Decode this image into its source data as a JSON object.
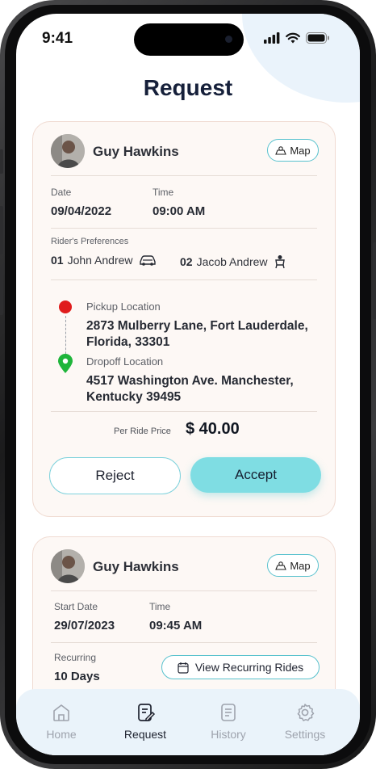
{
  "status_bar": {
    "time": "9:41"
  },
  "page": {
    "title": "Request"
  },
  "requests": [
    {
      "rider_name": "Guy Hawkins",
      "map_label": "Map",
      "date_label": "Date",
      "date": "09/04/2022",
      "time_label": "Time",
      "time": "09:00 AM",
      "preferences_label": "Rider's Preferences",
      "preferences": [
        {
          "number": "01",
          "name": "John Andrew",
          "icon": "car-icon"
        },
        {
          "number": "02",
          "name": "Jacob Andrew",
          "icon": "child-seat-icon"
        }
      ],
      "pickup_label": "Pickup Location",
      "pickup_address": "2873 Mulberry Lane, Fort Lauderdale, Florida, 33301",
      "dropoff_label": "Dropoff Location",
      "dropoff_address": "4517 Washington Ave. Manchester, Kentucky 39495",
      "price_label": "Per Ride Price",
      "price": "$ 40.00",
      "reject_label": "Reject",
      "accept_label": "Accept"
    },
    {
      "rider_name": "Guy Hawkins",
      "map_label": "Map",
      "start_date_label": "Start Date",
      "start_date": "29/07/2023",
      "time_label": "Time",
      "time": "09:45 AM",
      "recurring_label": "Recurring",
      "recurring_value": "10 Days",
      "view_recurring_label": "View Recurring Rides"
    }
  ],
  "tab_bar": {
    "items": [
      {
        "label": "Home",
        "icon": "home-icon",
        "active": false
      },
      {
        "label": "Request",
        "icon": "request-icon",
        "active": true
      },
      {
        "label": "History",
        "icon": "history-icon",
        "active": false
      },
      {
        "label": "Settings",
        "icon": "settings-icon",
        "active": false
      }
    ]
  },
  "colors": {
    "accent": "#7fdde3",
    "accent_border": "#59c2ce",
    "card_bg": "#fdf8f5",
    "title": "#16203a",
    "pickup_dot": "#e01c1c",
    "dropoff_pin": "#1fb53b",
    "tab_bar_bg": "#eaf3fa"
  }
}
